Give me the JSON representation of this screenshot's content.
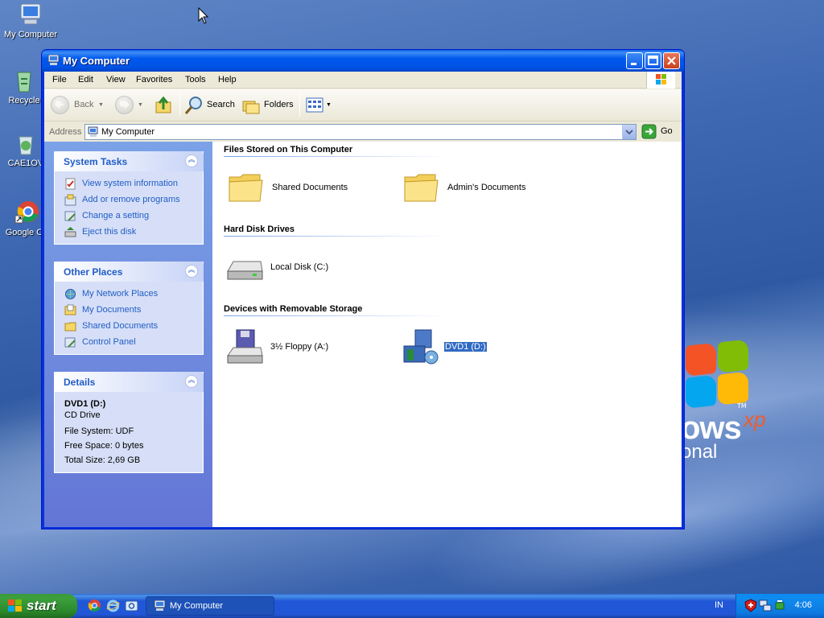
{
  "desktop": {
    "icons": [
      {
        "label": "My Computer"
      },
      {
        "label": "Recycle"
      },
      {
        "label": "CAE1OV"
      },
      {
        "label": "Google Ch"
      }
    ],
    "wallpaper_logo": {
      "word": "ows",
      "superscript": "xp",
      "tm": "TM",
      "subtitle": "onal"
    }
  },
  "window": {
    "title": "My Computer",
    "menu": [
      "File",
      "Edit",
      "View",
      "Favorites",
      "Tools",
      "Help"
    ],
    "toolbar": {
      "back": "Back",
      "search": "Search",
      "folders": "Folders"
    },
    "address": {
      "label": "Address",
      "value": "My Computer",
      "go": "Go"
    },
    "sidebar": {
      "system_tasks": {
        "title": "System Tasks",
        "items": [
          "View system information",
          "Add or remove programs",
          "Change a setting",
          "Eject this disk"
        ]
      },
      "other_places": {
        "title": "Other Places",
        "items": [
          "My Network Places",
          "My Documents",
          "Shared Documents",
          "Control Panel"
        ]
      },
      "details": {
        "title": "Details",
        "name": "DVD1 (D:)",
        "type": "CD Drive",
        "file_system": "File System: UDF",
        "free_space": "Free Space: 0 bytes",
        "total_size": "Total Size: 2,69 GB"
      }
    },
    "groups": [
      {
        "title": "Files Stored on This Computer",
        "items": [
          "Shared Documents",
          "Admin's Documents"
        ]
      },
      {
        "title": "Hard Disk Drives",
        "items": [
          "Local Disk (C:)"
        ]
      },
      {
        "title": "Devices with Removable Storage",
        "items": [
          "3½ Floppy (A:)",
          "DVD1 (D:)"
        ]
      }
    ],
    "selected_item": "DVD1 (D:)"
  },
  "taskbar": {
    "start_label": "start",
    "task_button": "My Computer",
    "language": "IN",
    "clock": "4:06"
  },
  "colors": {
    "title_blue": "#0058ee",
    "link_blue": "#215dc6",
    "start_green": "#3c9f3c",
    "selection": "#316ac5"
  }
}
